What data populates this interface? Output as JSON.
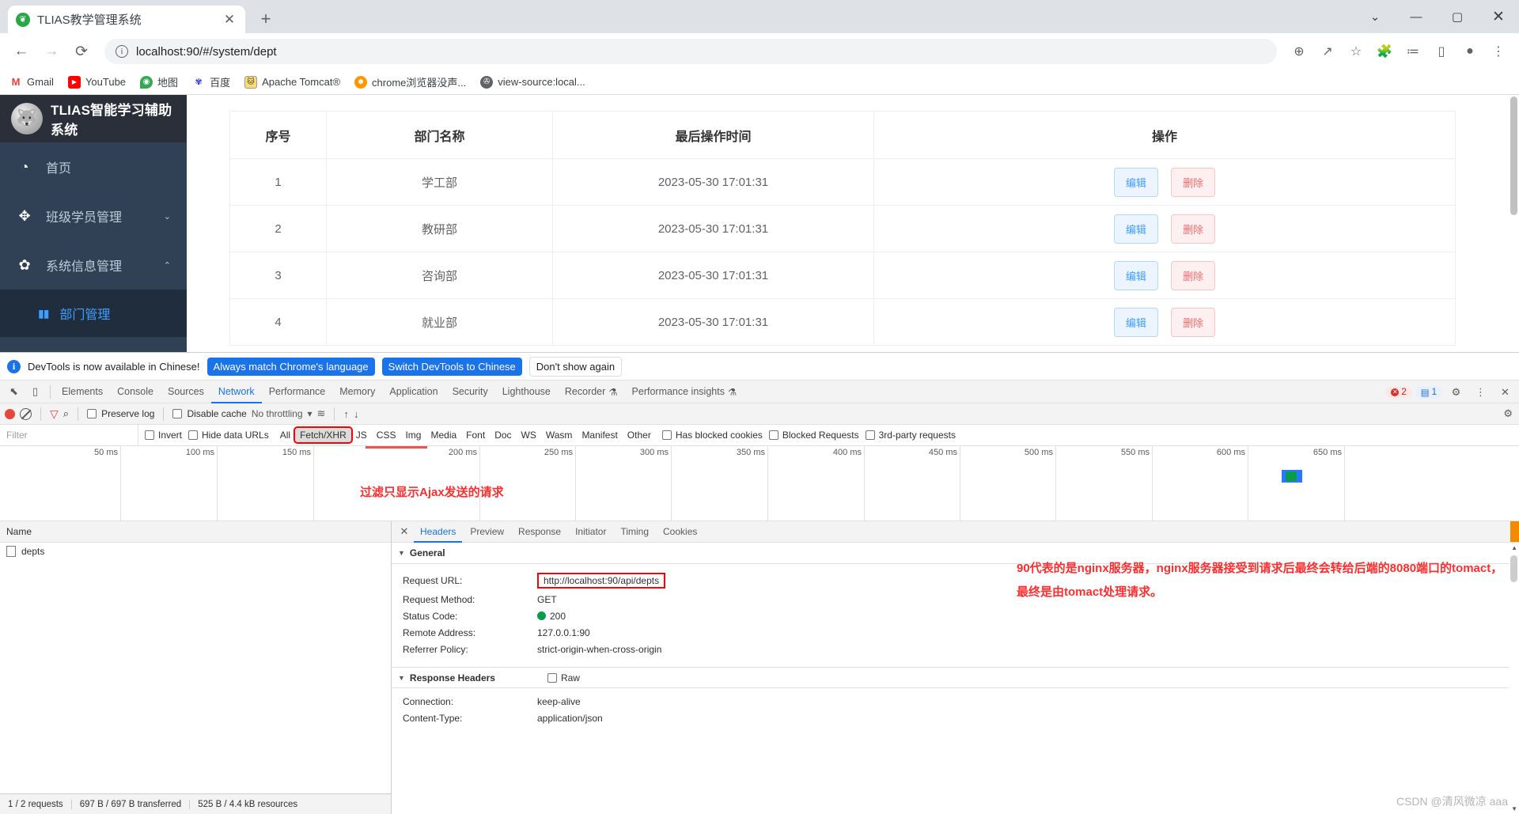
{
  "browser": {
    "tab": {
      "title": "TLIAS教学管理系统",
      "favicon": "leaf-icon",
      "close": "✕"
    },
    "newtab_label": "+",
    "window_controls": {
      "expand": "⌄",
      "minimize": "—",
      "maximize": "▢",
      "close": "✕"
    },
    "nav": {
      "back": "←",
      "forward": "→",
      "reload": "⟳"
    },
    "omnibox": {
      "info_icon": "i",
      "url": "localhost:90/#/system/dept",
      "url_host": "localhost:90",
      "url_path": "/#/system/dept"
    },
    "toolbar_icons": [
      "zoom-icon",
      "share-icon",
      "bookmark-star-icon",
      "extensions-icon",
      "reading-list-icon",
      "side-panel-icon",
      "profile-icon",
      "menu-icon"
    ],
    "toolbar_glyphs": {
      "zoom": "⊕",
      "share": "↗",
      "star": "☆",
      "extensions": "🧩",
      "readinglist": "≔",
      "sidepanel": "▯",
      "profile": "●",
      "menu": "⋮"
    },
    "bookmarks": [
      {
        "label": "Gmail",
        "icon": "gmail-icon",
        "glyph": "M",
        "color": "#ea4335",
        "bg": "#ffffff"
      },
      {
        "label": "YouTube",
        "icon": "youtube-icon",
        "glyph": "▶",
        "color": "#ffffff",
        "bg": "#ff0000"
      },
      {
        "label": "地图",
        "icon": "google-maps-icon",
        "glyph": "◉",
        "color": "#ffffff",
        "bg": "#34a853"
      },
      {
        "label": "百度",
        "icon": "baidu-icon",
        "glyph": "熊",
        "color": "#ffffff",
        "bg": "#2932e1"
      },
      {
        "label": "Apache Tomcat®",
        "icon": "tomcat-icon",
        "glyph": "🐱",
        "color": "#ffffff",
        "bg": "#f8dc75"
      },
      {
        "label": "chrome浏览器没声...",
        "icon": "chrome-page-icon",
        "glyph": "☻",
        "color": "#ffffff",
        "bg": "#ff9800"
      },
      {
        "label": "view-source:local...",
        "icon": "globe-icon",
        "glyph": "🌐",
        "color": "#ffffff",
        "bg": "#5f6368"
      }
    ]
  },
  "app": {
    "brand": {
      "title": "TLIAS智能学习辅助系统",
      "logo": "wolf-head-logo"
    },
    "sidebar": [
      {
        "id": "home",
        "label": "首页",
        "icon": "dashboard-icon",
        "glyph": "◔",
        "arrow": ""
      },
      {
        "id": "class-student",
        "label": "班级学员管理",
        "icon": "compass-icon",
        "glyph": "✥",
        "arrow": "⌄"
      },
      {
        "id": "system-info",
        "label": "系统信息管理",
        "icon": "gear-icon",
        "glyph": "✿",
        "arrow": "⌃"
      }
    ],
    "submenu": {
      "id": "dept",
      "label": "部门管理",
      "icon": "grid-icon",
      "glyph": "▮▮"
    },
    "table": {
      "columns": [
        "序号",
        "部门名称",
        "最后操作时间",
        "操作"
      ],
      "rows": [
        {
          "no": "1",
          "name": "学工部",
          "time": "2023-05-30 17:01:31",
          "edit": "编辑",
          "delete": "删除"
        },
        {
          "no": "2",
          "name": "教研部",
          "time": "2023-05-30 17:01:31",
          "edit": "编辑",
          "delete": "删除"
        },
        {
          "no": "3",
          "name": "咨询部",
          "time": "2023-05-30 17:01:31",
          "edit": "编辑",
          "delete": "删除"
        },
        {
          "no": "4",
          "name": "就业部",
          "time": "2023-05-30 17:01:31",
          "edit": "编辑",
          "delete": "删除"
        }
      ]
    }
  },
  "devtools": {
    "notice": {
      "icon": "info-icon",
      "text": "DevTools is now available in Chinese!",
      "btn_always": "Always match Chrome's language",
      "btn_switch": "Switch DevTools to Chinese",
      "btn_dismiss": "Don't show again"
    },
    "panel_icons": {
      "inspect": "⬉",
      "device": "▯"
    },
    "tabs": [
      {
        "label": "Elements",
        "active": false
      },
      {
        "label": "Console",
        "active": false
      },
      {
        "label": "Sources",
        "active": false
      },
      {
        "label": "Network",
        "active": true
      },
      {
        "label": "Performance",
        "active": false
      },
      {
        "label": "Memory",
        "active": false
      },
      {
        "label": "Application",
        "active": false
      },
      {
        "label": "Security",
        "active": false
      },
      {
        "label": "Lighthouse",
        "active": false
      },
      {
        "label": "Recorder",
        "active": false,
        "badge": "⚗"
      },
      {
        "label": "Performance insights",
        "active": false,
        "badge": "⚗"
      }
    ],
    "status_pills": {
      "errors": "2",
      "messages": "1"
    },
    "right_icons": {
      "settings": "⚙",
      "more": "⋮",
      "close": "✕"
    },
    "toolbar": {
      "record": "record-button",
      "clear": "clear-button",
      "filter": "filter-icon",
      "search": "search-icon",
      "preserve_log": "Preserve log",
      "disable_cache": "Disable cache",
      "throttling": "No throttling",
      "throttling_caret": "▾",
      "wifi": "wifi-icon",
      "import": "↑",
      "export": "↓",
      "settings_gear": "⚙"
    },
    "filterbar": {
      "placeholder": "Filter",
      "invert": "Invert",
      "hide_data_urls": "Hide data URLs",
      "types": [
        "All",
        "Fetch/XHR",
        "JS",
        "CSS",
        "Img",
        "Media",
        "Font",
        "Doc",
        "WS",
        "Wasm",
        "Manifest",
        "Other"
      ],
      "selected_type": "Fetch/XHR",
      "has_blocked_cookies": "Has blocked cookies",
      "blocked_requests": "Blocked Requests",
      "third_party": "3rd-party requests"
    },
    "timeline": {
      "ticks": [
        "50 ms",
        "100 ms",
        "150 ms",
        "200 ms",
        "250 ms",
        "300 ms",
        "350 ms",
        "400 ms",
        "450 ms",
        "500 ms",
        "550 ms",
        "600 ms",
        "650 ms"
      ],
      "annotation": "过滤只显示Ajax发送的请求"
    },
    "requests": {
      "column_name": "Name",
      "items": [
        {
          "name": "depts",
          "icon": "xhr-file-icon"
        }
      ]
    },
    "status_bar": {
      "requests": "1 / 2 requests",
      "transferred": "697 B / 697 B transferred",
      "resources": "525 B / 4.4 kB resources"
    },
    "detail": {
      "close": "✕",
      "tabs": [
        {
          "label": "Headers",
          "active": true
        },
        {
          "label": "Preview",
          "active": false
        },
        {
          "label": "Response",
          "active": false
        },
        {
          "label": "Initiator",
          "active": false
        },
        {
          "label": "Timing",
          "active": false
        },
        {
          "label": "Cookies",
          "active": false
        }
      ],
      "general": {
        "section": "General",
        "caret": "▼",
        "rows": [
          {
            "k": "Request URL:",
            "v": "http://localhost:90/api/depts",
            "boxed": true
          },
          {
            "k": "Request Method:",
            "v": "GET",
            "boxed": false
          },
          {
            "k": "Status Code:",
            "v": "200",
            "boxed": false,
            "status": true
          },
          {
            "k": "Remote Address:",
            "v": "127.0.0.1:90",
            "boxed": false
          },
          {
            "k": "Referrer Policy:",
            "v": "strict-origin-when-cross-origin",
            "boxed": false
          }
        ]
      },
      "annotation_line1": "90代表的是nginx服务器，nginx服务器接受到请求后最终会转给后端的8080端口的tomact，",
      "annotation_line2": "最终是由tomact处理请求。",
      "response_headers": {
        "section": "Response Headers",
        "caret": "▼",
        "raw_label": "Raw",
        "rows": [
          {
            "k": "Connection:",
            "v": "keep-alive"
          },
          {
            "k": "Content-Type:",
            "v": "application/json"
          }
        ]
      }
    }
  },
  "watermark": "CSDN @清风微凉 aaa",
  "colors": {
    "sidebar_bg": "#304156",
    "sidebar_brand_bg": "#2b2f3a",
    "submenu_bg": "#1f2d3d",
    "accent_blue": "#409eff",
    "devtools_blue": "#1a73e8",
    "annotation_red": "#ff2d2d",
    "delete_red": "#f56c6c",
    "status_green": "#0a9b4b"
  }
}
